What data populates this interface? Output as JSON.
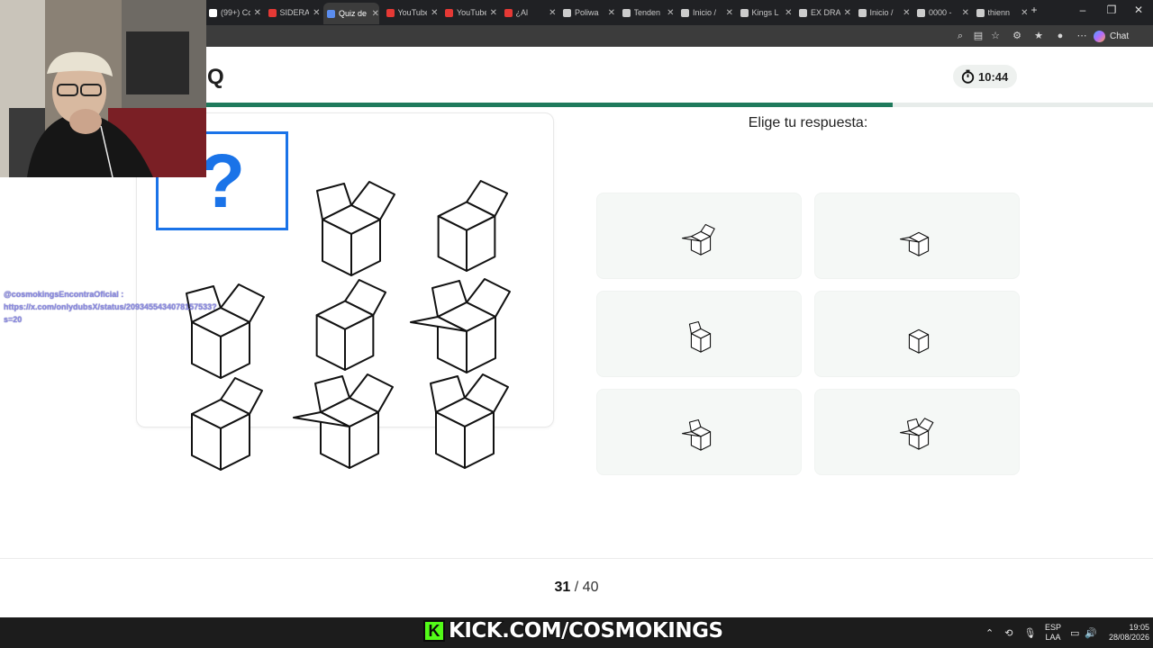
{
  "browser": {
    "tabs": [
      {
        "label": "(99+) Co",
        "color": "#ffffff"
      },
      {
        "label": "SIDERAL",
        "color": "#e53935"
      },
      {
        "label": "Quiz de",
        "color": "#5b8def",
        "active": true
      },
      {
        "label": "YouTube",
        "color": "#e53935"
      },
      {
        "label": "YouTube",
        "color": "#e53935"
      },
      {
        "label": "¿Al",
        "color": "#e53935"
      },
      {
        "label": "Poliwa",
        "color": "#cccccc"
      },
      {
        "label": "Tenden",
        "color": "#cccccc"
      },
      {
        "label": "Inicio /",
        "color": "#cccccc"
      },
      {
        "label": "Kings L",
        "color": "#cccccc"
      },
      {
        "label": "EX DRA",
        "color": "#cccccc"
      },
      {
        "label": "Inicio /",
        "color": "#cccccc"
      },
      {
        "label": "0000 -",
        "color": "#cccccc"
      },
      {
        "label": "thienn",
        "color": "#cccccc"
      }
    ],
    "tab_close": "✕",
    "new_tab": "+",
    "chat_label": "Chat"
  },
  "quiz": {
    "brand": "Q",
    "timer": "10:44",
    "progress_fraction": 0.774,
    "question_mark": "?",
    "prompt": "Elige tu respuesta:",
    "counter_current": "31",
    "counter_sep": " / ",
    "counter_total": "40"
  },
  "overlay": {
    "chat_lines": [
      "@cosmokingsEncontraOficial :",
      "https://x.com/onlydubsX/status/2093455434078157533?",
      "s=20"
    ],
    "kick_text": "KICK.COM/COSMOKINGS",
    "kick_logo": "K"
  },
  "taskbar": {
    "lang_top": "ESP",
    "lang_bottom": "LAA",
    "time": "19:05",
    "date": "28/08/2026"
  }
}
